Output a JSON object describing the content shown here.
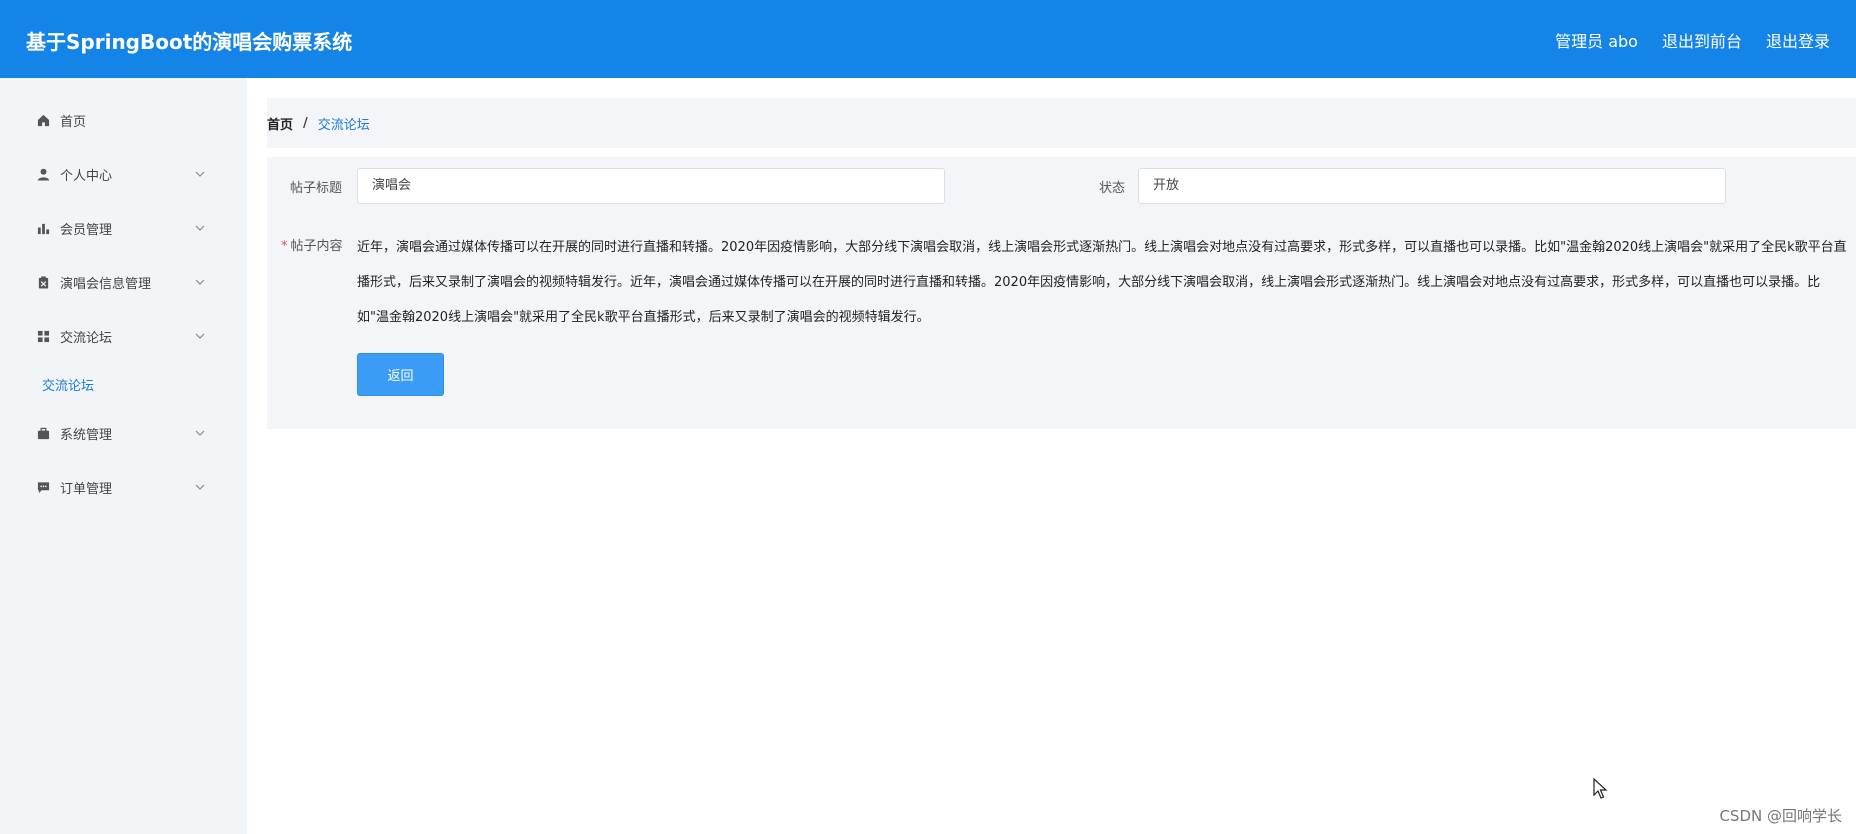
{
  "header": {
    "app_title": "基于SpringBoot的演唱会购票系统",
    "user_label": "管理员 abo",
    "to_frontend": "退出到前台",
    "logout": "退出登录",
    "bg_color": "#1584e8"
  },
  "sidebar": {
    "items": [
      {
        "label": "首页",
        "icon": "home-icon"
      },
      {
        "label": "个人中心",
        "icon": "user-icon"
      },
      {
        "label": "会员管理",
        "icon": "bar-chart-icon"
      },
      {
        "label": "演唱会信息管理",
        "icon": "clipboard-icon"
      },
      {
        "label": "交流论坛",
        "icon": "grid-icon"
      },
      {
        "label": "系统管理",
        "icon": "briefcase-icon"
      },
      {
        "label": "订单管理",
        "icon": "message-icon"
      }
    ],
    "sub_item": "交流论坛"
  },
  "breadcrumb": {
    "home": "首页",
    "separator": "/",
    "current": "交流论坛"
  },
  "form": {
    "title_label": "帖子标题",
    "title_value": "演唱会",
    "status_label": "状态",
    "status_value": "开放",
    "required_mark": "*",
    "content_label": "帖子内容",
    "content_value": "近年，演唱会通过媒体传播可以在开展的同时进行直播和转播。2020年因疫情影响，大部分线下演唱会取消，线上演唱会形式逐渐热门。线上演唱会对地点没有过高要求，形式多样，可以直播也可以录播。比如\"温金翰2020线上演唱会\"就采用了全民k歌平台直播形式，后来又录制了演唱会的视频特辑发行。近年，演唱会通过媒体传播可以在开展的同时进行直播和转播。2020年因疫情影响，大部分线下演唱会取消，线上演唱会形式逐渐热门。线上演唱会对地点没有过高要求，形式多样，可以直播也可以录播。比如\"温金翰2020线上演唱会\"就采用了全民k歌平台直播形式，后来又录制了演唱会的视频特辑发行。",
    "back_button": "返回"
  },
  "watermark": "CSDN @回响学长"
}
